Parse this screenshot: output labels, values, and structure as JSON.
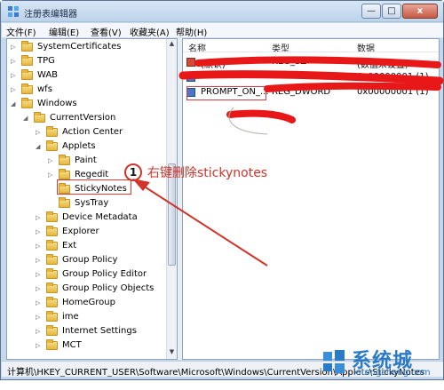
{
  "window": {
    "title": "注册表编辑器",
    "minimize": "—",
    "maximize": "□",
    "close": "x"
  },
  "menu": [
    "文件(F)",
    "编辑(E)",
    "查看(V)",
    "收藏夹(A)",
    "帮助(H)"
  ],
  "tree": [
    {
      "label": "SystemCertificates",
      "expander": "▷"
    },
    {
      "label": "TPG",
      "expander": "▷"
    },
    {
      "label": "WAB",
      "expander": "▷"
    },
    {
      "label": "wfs",
      "expander": "▷"
    },
    {
      "label": "Windows",
      "expander": "◢"
    },
    {
      "label": "CurrentVersion",
      "expander": "◢"
    },
    {
      "label": "Action Center",
      "expander": "▷"
    },
    {
      "label": "Applets",
      "expander": "◢"
    },
    {
      "label": "Paint",
      "expander": "▷"
    },
    {
      "label": "Regedit",
      "expander": "▷"
    },
    {
      "label": "StickyNotes",
      "expander": ""
    },
    {
      "label": "SysTray",
      "expander": ""
    },
    {
      "label": "Device Metadata",
      "expander": "▷"
    },
    {
      "label": "Explorer",
      "expander": "▷"
    },
    {
      "label": "Ext",
      "expander": "▷"
    },
    {
      "label": "Group Policy",
      "expander": "▷"
    },
    {
      "label": "Group Policy Editor",
      "expander": "▷"
    },
    {
      "label": "Group Policy Objects",
      "expander": "▷"
    },
    {
      "label": "HomeGroup",
      "expander": "▷"
    },
    {
      "label": "ime",
      "expander": "▷"
    },
    {
      "label": "Internet Settings",
      "expander": "▷"
    },
    {
      "label": "MCT",
      "expander": "▷"
    }
  ],
  "values": {
    "headers": {
      "name": "名称",
      "type": "类型",
      "data": "数据"
    },
    "rows": [
      {
        "name": "(默认)",
        "type": "REG_SZ",
        "data": "(数值未设置)"
      },
      {
        "name": "",
        "type": "",
        "data": "0x00000001 (1)"
      },
      {
        "name": "PROMPT_ON_...",
        "type": "REG_DWORD",
        "data": "0x00000001 (1)"
      }
    ]
  },
  "annotation": {
    "number": "1",
    "text": "右键删除stickynotes",
    "color": "#d0342a"
  },
  "status": {
    "path": "计算机\\HKEY_CURRENT_USER\\Software\\Microsoft\\Windows\\CurrentVersion\\Applets\\StickyNotes"
  },
  "watermark": {
    "brand": "系统城",
    "domain": "xitongcheng.com"
  }
}
